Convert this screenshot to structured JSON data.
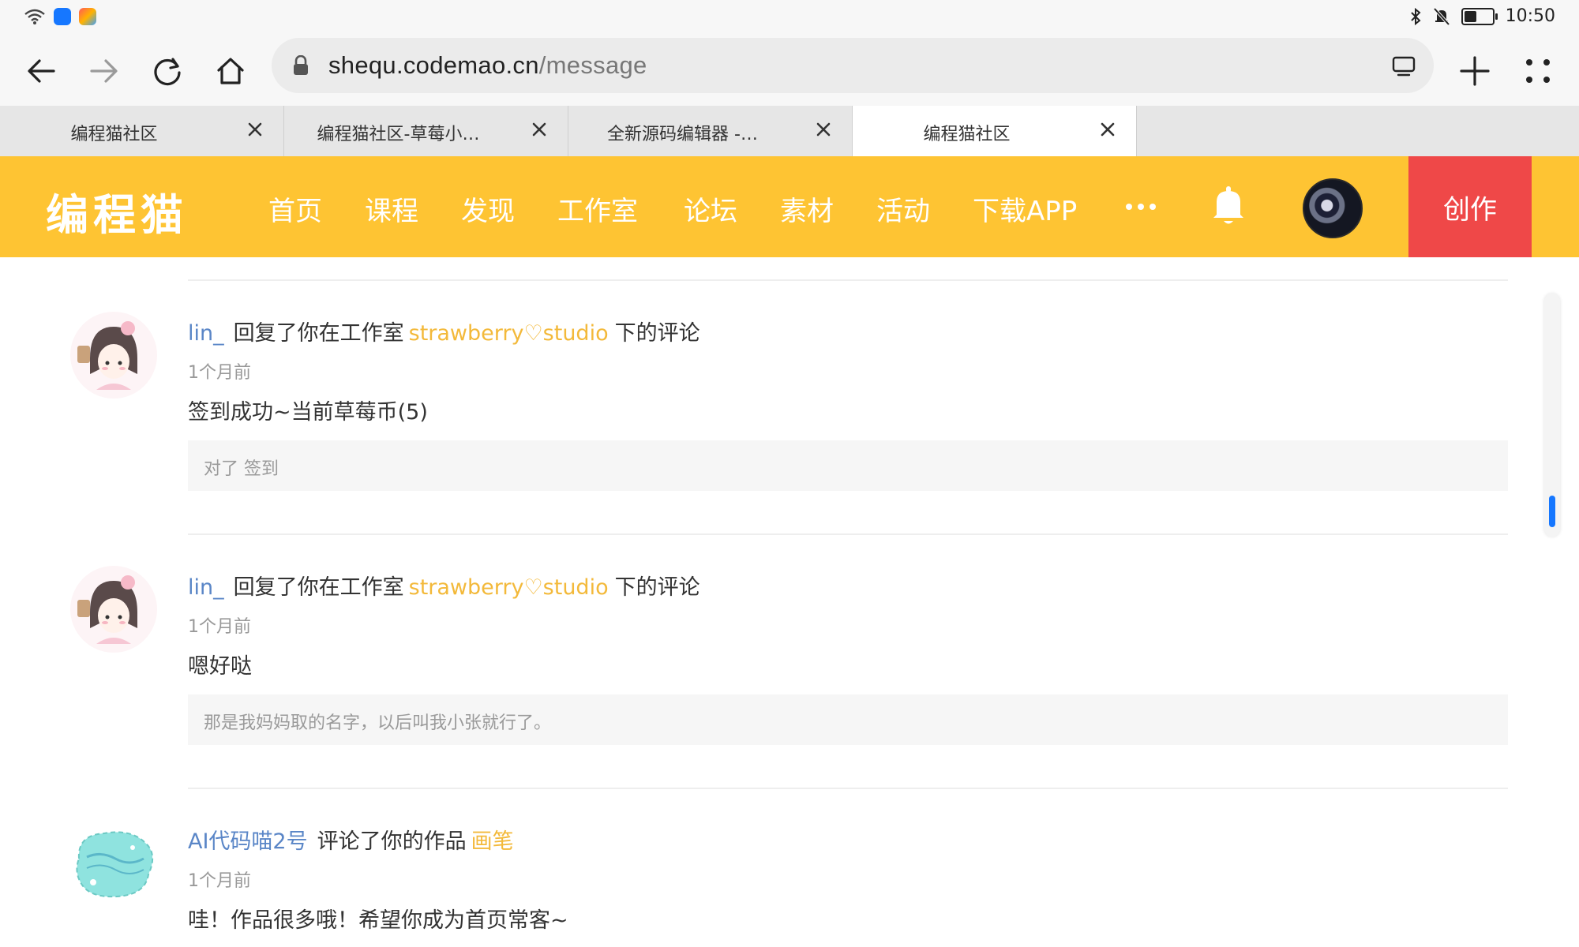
{
  "status_bar": {
    "time": "10:50",
    "battery_level": 0.45,
    "app_icons": [
      "wifi-signal-icon",
      "blue-app-icon",
      "colorful-app-icon"
    ],
    "system_icons": [
      "bluetooth-icon",
      "mute-icon",
      "battery-icon"
    ]
  },
  "browser": {
    "url_host": "shequ.codemao.cn",
    "url_path": "/message",
    "tabs": [
      {
        "title": "编程猫社区",
        "active": false
      },
      {
        "title": "编程猫社区-草莓小…",
        "active": false
      },
      {
        "title": "全新源码编辑器 -…",
        "active": false
      },
      {
        "title": "编程猫社区",
        "active": true
      }
    ]
  },
  "site": {
    "logo": "编程猫",
    "nav": [
      "首页",
      "课程",
      "发现",
      "工作室",
      "论坛",
      "素材",
      "活动",
      "下载APP"
    ],
    "create_label": "创作",
    "brand_color": "#fec433",
    "create_color": "#ef4848"
  },
  "messages": [
    {
      "user": "lin_",
      "action": "回复了你在工作室",
      "target": "strawberry♡studio",
      "suffix": "下的评论",
      "time": "1个月前",
      "body": "签到成功~当前草莓币(5)",
      "quote": "对了 签到"
    },
    {
      "user": "lin_",
      "action": "回复了你在工作室",
      "target": "strawberry♡studio",
      "suffix": "下的评论",
      "time": "1个月前",
      "body": "嗯好哒",
      "quote": "那是我妈妈取的名字，以后叫我小张就行了。"
    },
    {
      "user": "AI代码喵2号",
      "action": "评论了你的作品",
      "target": "画笔",
      "suffix": "",
      "time": "1个月前",
      "body": "哇！作品很多哦！希望你成为首页常客~",
      "quote": ""
    }
  ]
}
